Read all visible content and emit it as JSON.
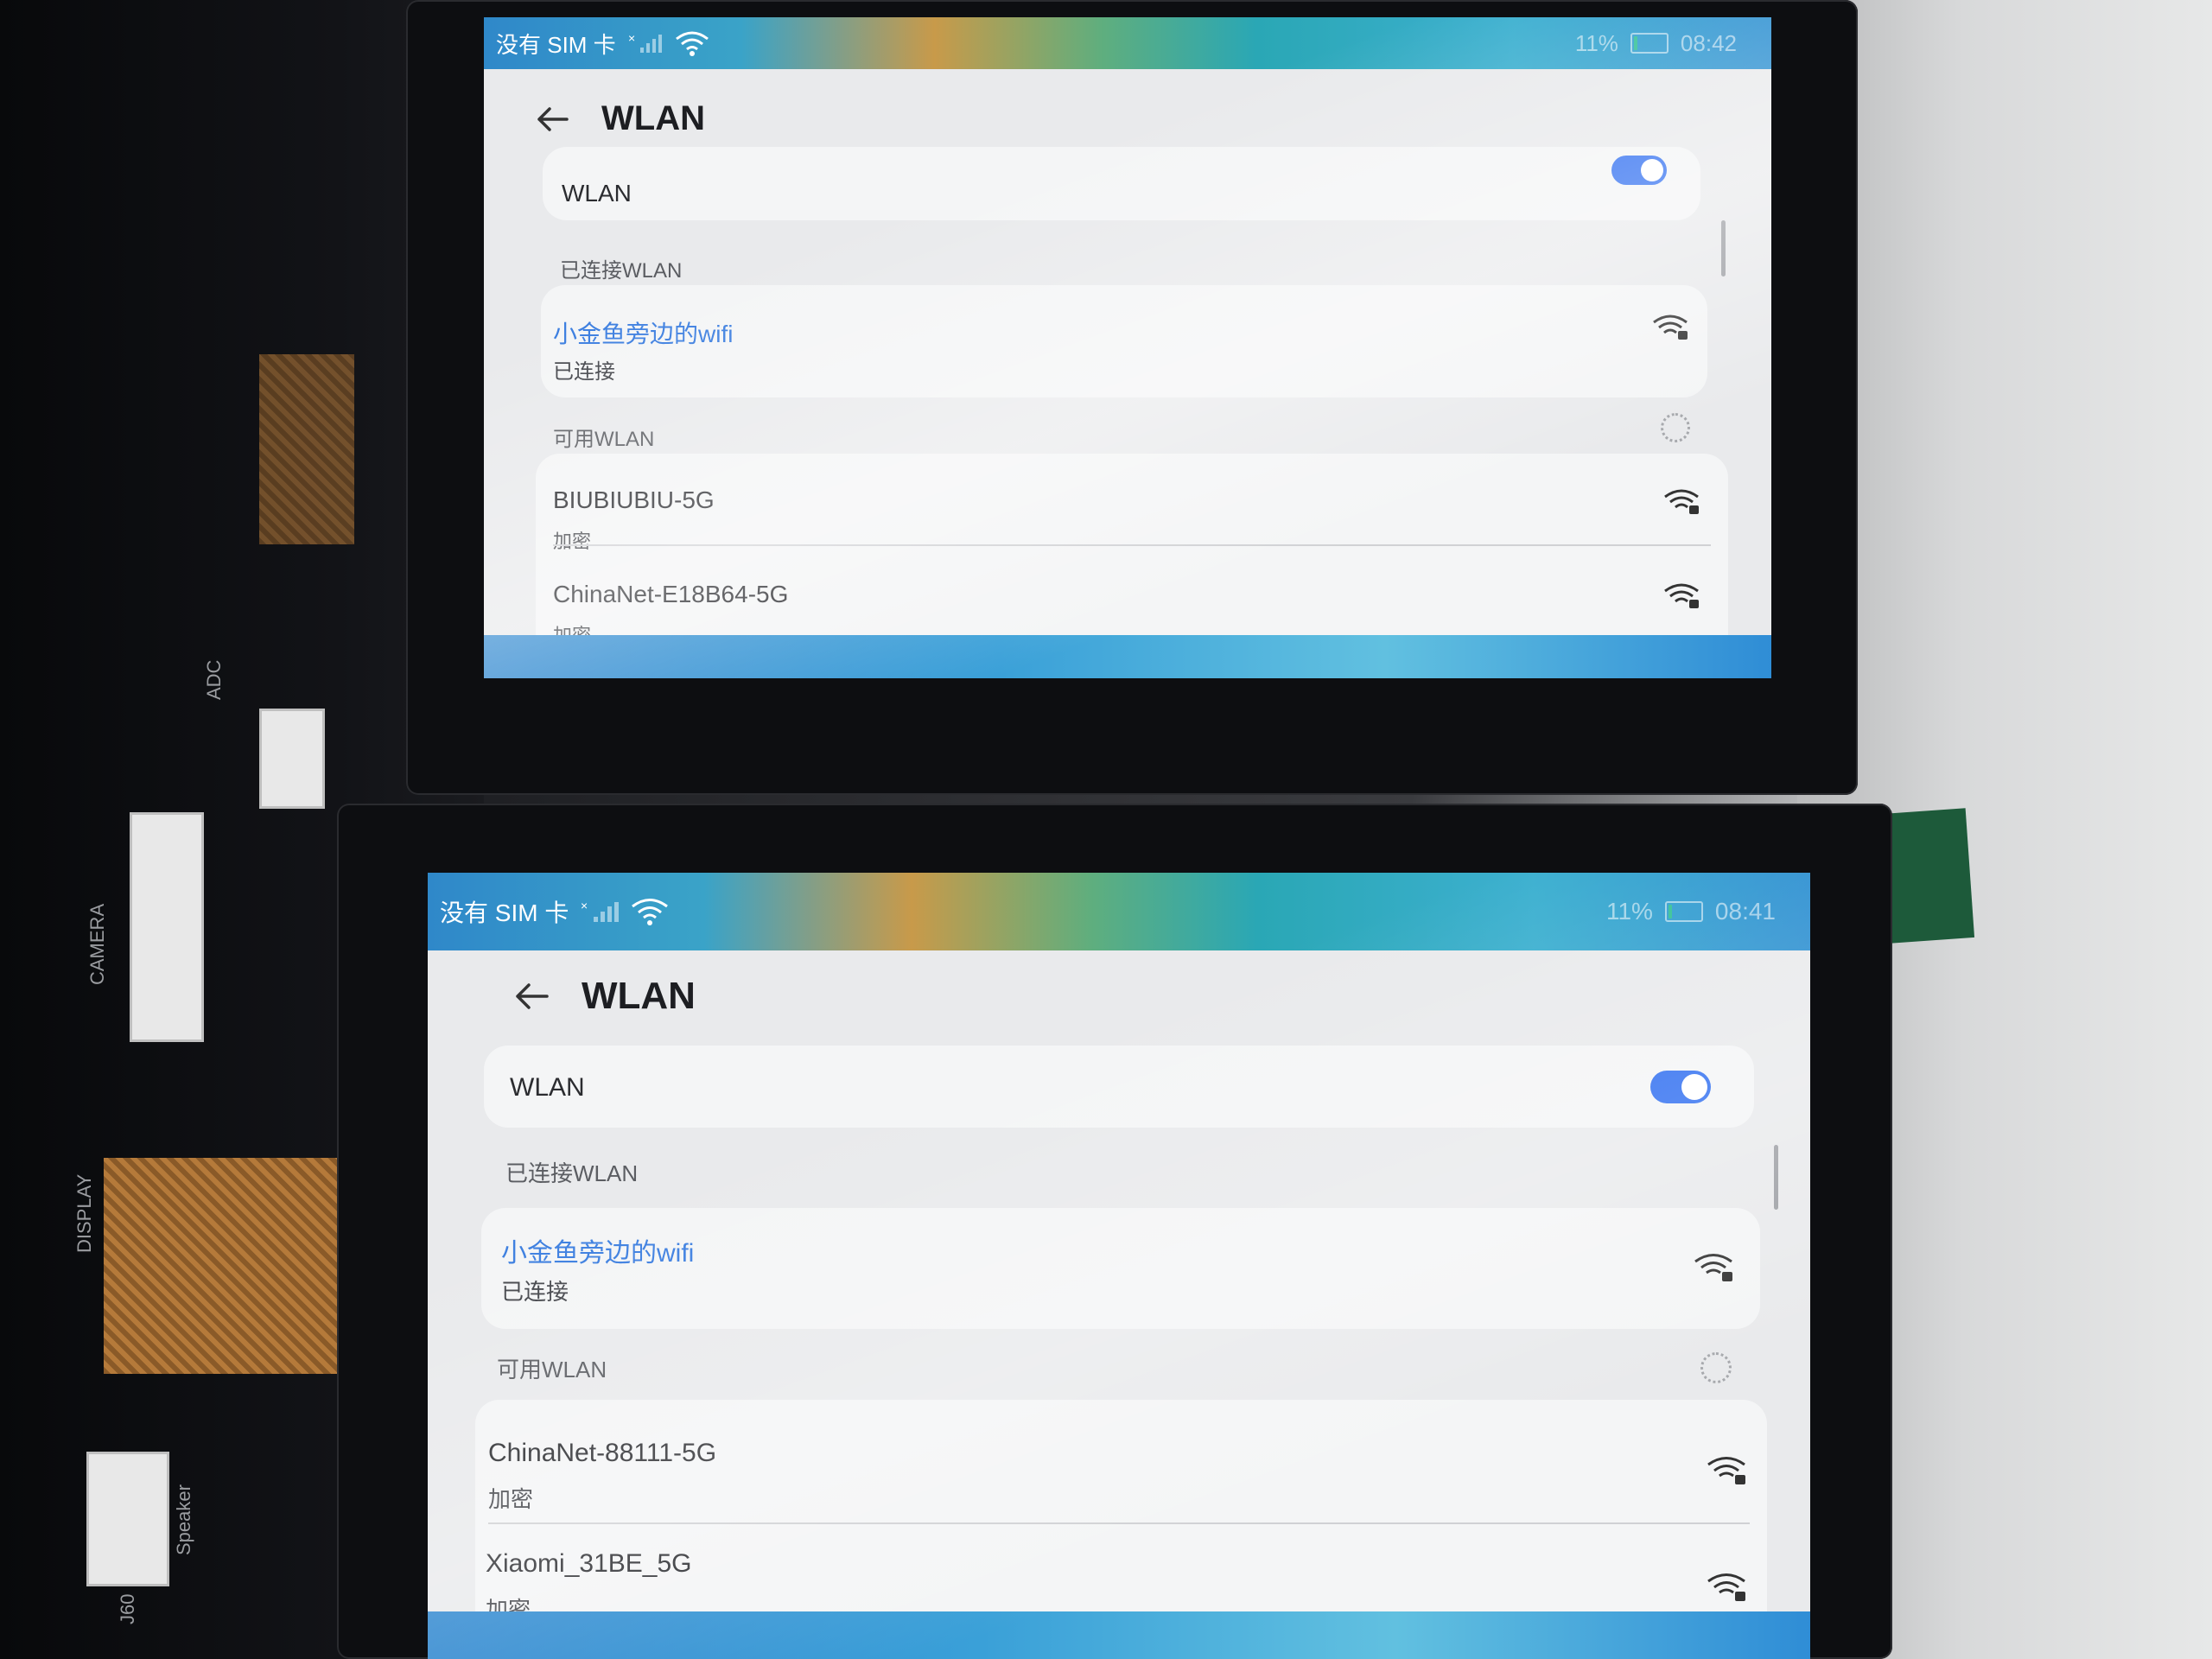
{
  "colors": {
    "accent": "#3d7fe0",
    "toggle_on": "#2f6ef0",
    "screen_bg": "#e9eaec",
    "card_bg": "#f4f5f6",
    "battery_fill": "#3adf6a"
  },
  "board": {
    "labels": [
      "CAMERA",
      "DISPLAY",
      "Speaker",
      "ADC",
      "J60"
    ]
  },
  "screens": [
    {
      "status": {
        "carrier": "没有 SIM 卡",
        "battery_percent": "11%",
        "time": "08:42",
        "icons": [
          "no-signal-icon",
          "wifi-icon",
          "battery-icon"
        ]
      },
      "header": {
        "back_icon": "back-arrow-icon",
        "title": "WLAN"
      },
      "wlan_toggle": {
        "label": "WLAN",
        "on": true
      },
      "connected_section": "已连接WLAN",
      "connected": {
        "ssid": "小金鱼旁边的wifi",
        "status": "已连接",
        "icon": "wifi-lock-icon"
      },
      "available_section": "可用WLAN",
      "available": [
        {
          "ssid": "BIUBIUBIU-5G",
          "security": "加密",
          "icon": "wifi-lock-icon"
        },
        {
          "ssid": "ChinaNet-E18B64-5G",
          "security": "加密",
          "icon": "wifi-lock-icon"
        }
      ]
    },
    {
      "status": {
        "carrier": "没有 SIM 卡",
        "battery_percent": "11%",
        "time": "08:41",
        "icons": [
          "no-signal-icon",
          "wifi-icon",
          "battery-icon"
        ]
      },
      "header": {
        "back_icon": "back-arrow-icon",
        "title": "WLAN"
      },
      "wlan_toggle": {
        "label": "WLAN",
        "on": true
      },
      "connected_section": "已连接WLAN",
      "connected": {
        "ssid": "小金鱼旁边的wifi",
        "status": "已连接",
        "icon": "wifi-lock-icon"
      },
      "available_section": "可用WLAN",
      "available": [
        {
          "ssid": "ChinaNet-88111-5G",
          "security": "加密",
          "icon": "wifi-lock-icon"
        },
        {
          "ssid": "Xiaomi_31BE_5G",
          "security": "加密",
          "icon": "wifi-lock-icon"
        }
      ]
    }
  ]
}
